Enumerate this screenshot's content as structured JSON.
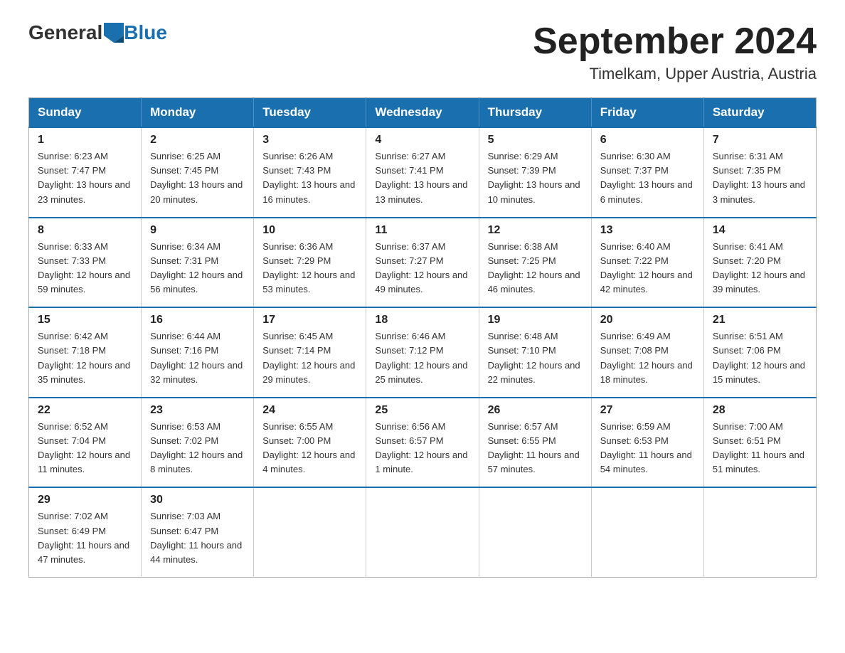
{
  "header": {
    "logo_general": "General",
    "logo_blue": "Blue",
    "month": "September 2024",
    "location": "Timelkam, Upper Austria, Austria"
  },
  "weekdays": [
    "Sunday",
    "Monday",
    "Tuesday",
    "Wednesday",
    "Thursday",
    "Friday",
    "Saturday"
  ],
  "weeks": [
    [
      {
        "day": "1",
        "sunrise": "6:23 AM",
        "sunset": "7:47 PM",
        "daylight": "13 hours and 23 minutes."
      },
      {
        "day": "2",
        "sunrise": "6:25 AM",
        "sunset": "7:45 PM",
        "daylight": "13 hours and 20 minutes."
      },
      {
        "day": "3",
        "sunrise": "6:26 AM",
        "sunset": "7:43 PM",
        "daylight": "13 hours and 16 minutes."
      },
      {
        "day": "4",
        "sunrise": "6:27 AM",
        "sunset": "7:41 PM",
        "daylight": "13 hours and 13 minutes."
      },
      {
        "day": "5",
        "sunrise": "6:29 AM",
        "sunset": "7:39 PM",
        "daylight": "13 hours and 10 minutes."
      },
      {
        "day": "6",
        "sunrise": "6:30 AM",
        "sunset": "7:37 PM",
        "daylight": "13 hours and 6 minutes."
      },
      {
        "day": "7",
        "sunrise": "6:31 AM",
        "sunset": "7:35 PM",
        "daylight": "13 hours and 3 minutes."
      }
    ],
    [
      {
        "day": "8",
        "sunrise": "6:33 AM",
        "sunset": "7:33 PM",
        "daylight": "12 hours and 59 minutes."
      },
      {
        "day": "9",
        "sunrise": "6:34 AM",
        "sunset": "7:31 PM",
        "daylight": "12 hours and 56 minutes."
      },
      {
        "day": "10",
        "sunrise": "6:36 AM",
        "sunset": "7:29 PM",
        "daylight": "12 hours and 53 minutes."
      },
      {
        "day": "11",
        "sunrise": "6:37 AM",
        "sunset": "7:27 PM",
        "daylight": "12 hours and 49 minutes."
      },
      {
        "day": "12",
        "sunrise": "6:38 AM",
        "sunset": "7:25 PM",
        "daylight": "12 hours and 46 minutes."
      },
      {
        "day": "13",
        "sunrise": "6:40 AM",
        "sunset": "7:22 PM",
        "daylight": "12 hours and 42 minutes."
      },
      {
        "day": "14",
        "sunrise": "6:41 AM",
        "sunset": "7:20 PM",
        "daylight": "12 hours and 39 minutes."
      }
    ],
    [
      {
        "day": "15",
        "sunrise": "6:42 AM",
        "sunset": "7:18 PM",
        "daylight": "12 hours and 35 minutes."
      },
      {
        "day": "16",
        "sunrise": "6:44 AM",
        "sunset": "7:16 PM",
        "daylight": "12 hours and 32 minutes."
      },
      {
        "day": "17",
        "sunrise": "6:45 AM",
        "sunset": "7:14 PM",
        "daylight": "12 hours and 29 minutes."
      },
      {
        "day": "18",
        "sunrise": "6:46 AM",
        "sunset": "7:12 PM",
        "daylight": "12 hours and 25 minutes."
      },
      {
        "day": "19",
        "sunrise": "6:48 AM",
        "sunset": "7:10 PM",
        "daylight": "12 hours and 22 minutes."
      },
      {
        "day": "20",
        "sunrise": "6:49 AM",
        "sunset": "7:08 PM",
        "daylight": "12 hours and 18 minutes."
      },
      {
        "day": "21",
        "sunrise": "6:51 AM",
        "sunset": "7:06 PM",
        "daylight": "12 hours and 15 minutes."
      }
    ],
    [
      {
        "day": "22",
        "sunrise": "6:52 AM",
        "sunset": "7:04 PM",
        "daylight": "12 hours and 11 minutes."
      },
      {
        "day": "23",
        "sunrise": "6:53 AM",
        "sunset": "7:02 PM",
        "daylight": "12 hours and 8 minutes."
      },
      {
        "day": "24",
        "sunrise": "6:55 AM",
        "sunset": "7:00 PM",
        "daylight": "12 hours and 4 minutes."
      },
      {
        "day": "25",
        "sunrise": "6:56 AM",
        "sunset": "6:57 PM",
        "daylight": "12 hours and 1 minute."
      },
      {
        "day": "26",
        "sunrise": "6:57 AM",
        "sunset": "6:55 PM",
        "daylight": "11 hours and 57 minutes."
      },
      {
        "day": "27",
        "sunrise": "6:59 AM",
        "sunset": "6:53 PM",
        "daylight": "11 hours and 54 minutes."
      },
      {
        "day": "28",
        "sunrise": "7:00 AM",
        "sunset": "6:51 PM",
        "daylight": "11 hours and 51 minutes."
      }
    ],
    [
      {
        "day": "29",
        "sunrise": "7:02 AM",
        "sunset": "6:49 PM",
        "daylight": "11 hours and 47 minutes."
      },
      {
        "day": "30",
        "sunrise": "7:03 AM",
        "sunset": "6:47 PM",
        "daylight": "11 hours and 44 minutes."
      },
      null,
      null,
      null,
      null,
      null
    ]
  ]
}
